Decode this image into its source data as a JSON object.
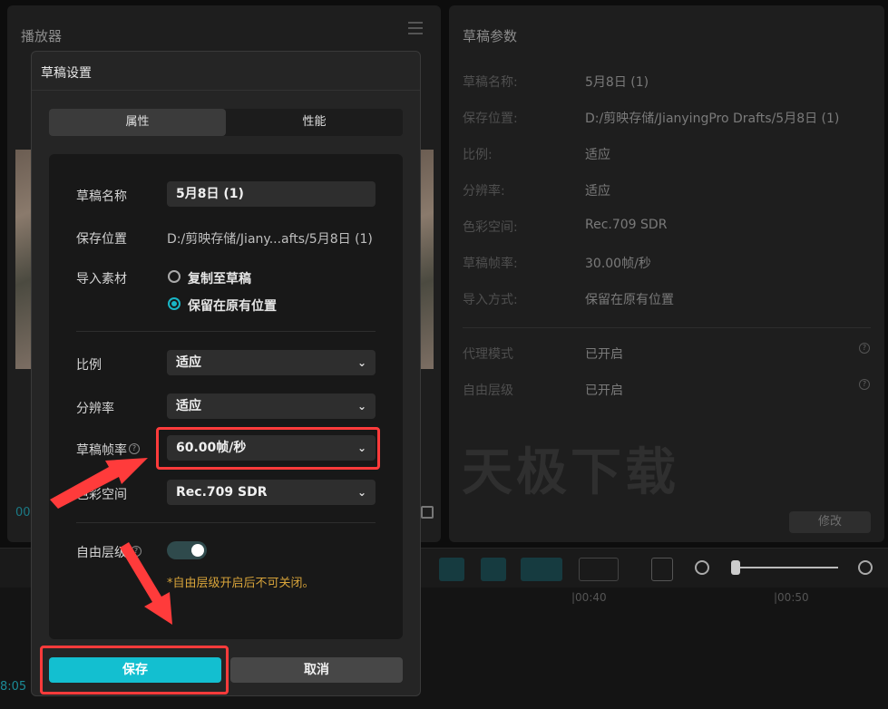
{
  "player": {
    "title": "播放器",
    "time_partial": "00",
    "timeline_time_partial": "8:05"
  },
  "params": {
    "title": "草稿参数",
    "rows": [
      {
        "label": "草稿名称:",
        "value": "5月8日 (1)"
      },
      {
        "label": "保存位置:",
        "value": "D:/剪映存储/JianyingPro Drafts/5月8日 (1)"
      },
      {
        "label": "比例:",
        "value": "适应"
      },
      {
        "label": "分辨率:",
        "value": "适应"
      },
      {
        "label": "色彩空间:",
        "value": "Rec.709 SDR"
      },
      {
        "label": "草稿帧率:",
        "value": "30.00帧/秒"
      },
      {
        "label": "导入方式:",
        "value": "保留在原有位置"
      }
    ],
    "rows2": [
      {
        "label": "代理模式",
        "value": "已开启"
      },
      {
        "label": "自由层级",
        "value": "已开启"
      }
    ],
    "watermark": "天极下载",
    "modify_label": "修改"
  },
  "timeline": {
    "ticks": [
      "|00:40",
      "|00:50"
    ]
  },
  "dialog": {
    "title": "草稿设置",
    "tabs": [
      "属性",
      "性能"
    ],
    "fields": {
      "name_label": "草稿名称",
      "name_value": "5月8日 (1)",
      "path_label": "保存位置",
      "path_value": "D:/剪映存储/Jiany...afts/5月8日 (1)",
      "import_label": "导入素材",
      "import_option1": "复制至草稿",
      "import_option2": "保留在原有位置",
      "ratio_label": "比例",
      "ratio_value": "适应",
      "res_label": "分辨率",
      "res_value": "适应",
      "fps_label": "草稿帧率",
      "fps_value": "60.00帧/秒",
      "color_label": "色彩空间",
      "color_value": "Rec.709 SDR",
      "layer_label": "自由层级",
      "layer_hint": "*自由层级开启后不可关闭。"
    },
    "save_label": "保存",
    "cancel_label": "取消"
  },
  "colors": {
    "accent": "#13bfd0",
    "highlight": "#ff3b3b",
    "hint": "#d8a43a"
  }
}
